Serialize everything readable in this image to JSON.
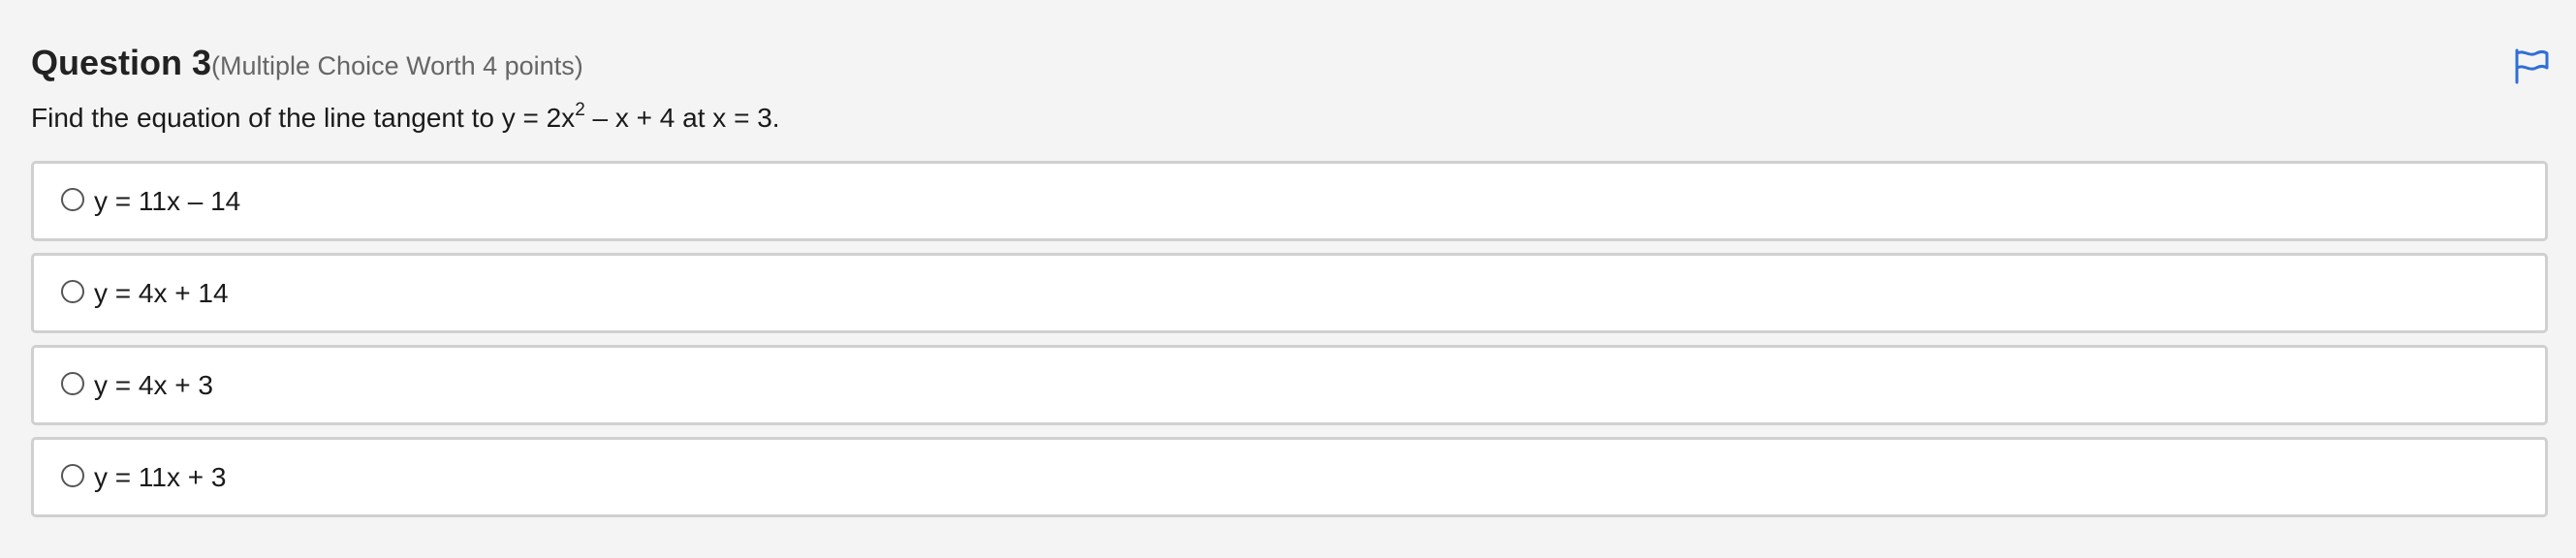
{
  "question": {
    "title": "Question 3",
    "meta": "(Multiple Choice Worth 4 points)",
    "prompt_before": "Find the equation of the line tangent to y = 2x",
    "prompt_exponent": "2",
    "prompt_after": " – x + 4 at x = 3."
  },
  "flag": {
    "icon": "flag-icon",
    "color": "#2f6fd6"
  },
  "options": [
    {
      "label": "y = 11x – 14",
      "selected": false
    },
    {
      "label": "y = 4x + 14",
      "selected": false
    },
    {
      "label": "y = 4x + 3",
      "selected": false
    },
    {
      "label": "y = 11x + 3",
      "selected": false
    }
  ]
}
